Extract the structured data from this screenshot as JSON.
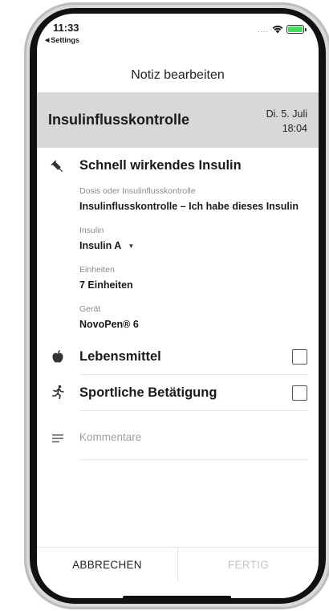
{
  "status_bar": {
    "time": "11:33",
    "back_app": "Settings",
    "signal_dots": "....",
    "battery_color": "#4cd964"
  },
  "nav": {
    "title": "Notiz bearbeiten"
  },
  "header": {
    "title": "Insulinflusskontrolle",
    "date": "Di. 5. Juli",
    "time": "18:04",
    "background": "#d8d8d8"
  },
  "insulin_section": {
    "icon": "syringe-icon",
    "title": "Schnell wirkendes Insulin",
    "dose_label": "Dosis oder Insulinflusskontrolle",
    "dose_value": "Insulinflusskontrolle – Ich habe dieses Insulin",
    "insulin_label": "Insulin",
    "insulin_value": "Insulin A",
    "units_label": "Einheiten",
    "units_value": "7 Einheiten",
    "device_label": "Gerät",
    "device_value": "NovoPen® 6"
  },
  "food": {
    "icon": "apple-icon",
    "label": "Lebensmittel",
    "checked": false
  },
  "sport": {
    "icon": "running-person-icon",
    "label": "Sportliche Betätigung",
    "checked": false
  },
  "comments": {
    "icon": "lines-icon",
    "placeholder": "Kommentare"
  },
  "footer": {
    "cancel_label": "ABBRECHEN",
    "done_label": "FERTIG",
    "done_color": "#c4c4c4"
  }
}
